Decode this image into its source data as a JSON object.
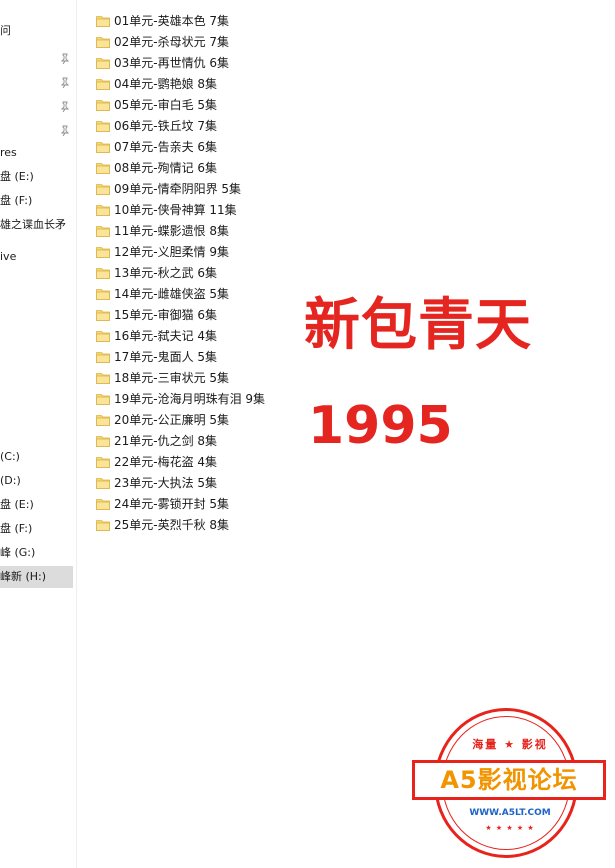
{
  "nav": {
    "items": [
      {
        "label": "问",
        "pinned": false
      },
      {
        "label": "",
        "pinned": true
      },
      {
        "label": "",
        "pinned": true
      },
      {
        "label": "",
        "pinned": true
      },
      {
        "label": "",
        "pinned": true
      },
      {
        "label": "res",
        "pinned": false
      },
      {
        "label": "盘 (E:)",
        "pinned": false
      },
      {
        "label": "盘 (F:)",
        "pinned": false
      },
      {
        "label": "雄之谍血长矛",
        "pinned": false
      },
      {
        "label": "ive",
        "pinned": false
      },
      {
        "label": "(C:)",
        "pinned": false
      },
      {
        "label": "(D:)",
        "pinned": false
      },
      {
        "label": "盘 (E:)",
        "pinned": false
      },
      {
        "label": "盘 (F:)",
        "pinned": false
      },
      {
        "label": "峰 (G:)",
        "pinned": false
      },
      {
        "label": "峰新 (H:)",
        "pinned": false,
        "selected": true
      }
    ]
  },
  "files": [
    "01单元-英雄本色 7集",
    "02单元-杀母状元 7集",
    "03单元-再世情仇 6集",
    "04单元-鹦艳娘 8集",
    "05单元-审白毛 5集",
    "06单元-铁丘坟 7集",
    "07单元-告亲夫 6集",
    "08单元-殉情记 6集",
    "09单元-情牵阴阳界 5集",
    "10单元-侠骨神算 11集",
    "11单元-蝶影遗恨 8集",
    "12单元-义胆柔情 9集",
    "13单元-秋之武 6集",
    "14单元-雌雄侠盗 5集",
    "15单元-审御猫 6集",
    "16单元-弑夫记 4集",
    "17单元-鬼面人 5集",
    "18单元-三审状元 5集",
    "19单元-沧海月明珠有泪 9集",
    "20单元-公正廉明 5集",
    "21单元-仇之剑 8集",
    "22单元-梅花盗 4集",
    "23单元-大执法 5集",
    "24单元-雾锁开封 5集",
    "25单元-英烈千秋 8集"
  ],
  "overlay": {
    "title": "新包青天",
    "year": "1995"
  },
  "watermark": {
    "top_text": "海量 ★ 影视",
    "banner": "A5影视论坛",
    "url": "WWW.A5LT.COM",
    "stars": "★ ★ ★ ★ ★"
  },
  "colors": {
    "accent_red": "#e52520",
    "folder_yellow": "#f7d774",
    "banner_orange": "#f29400",
    "url_blue": "#1e63c6",
    "nav_selected": "#dcdcdc"
  }
}
